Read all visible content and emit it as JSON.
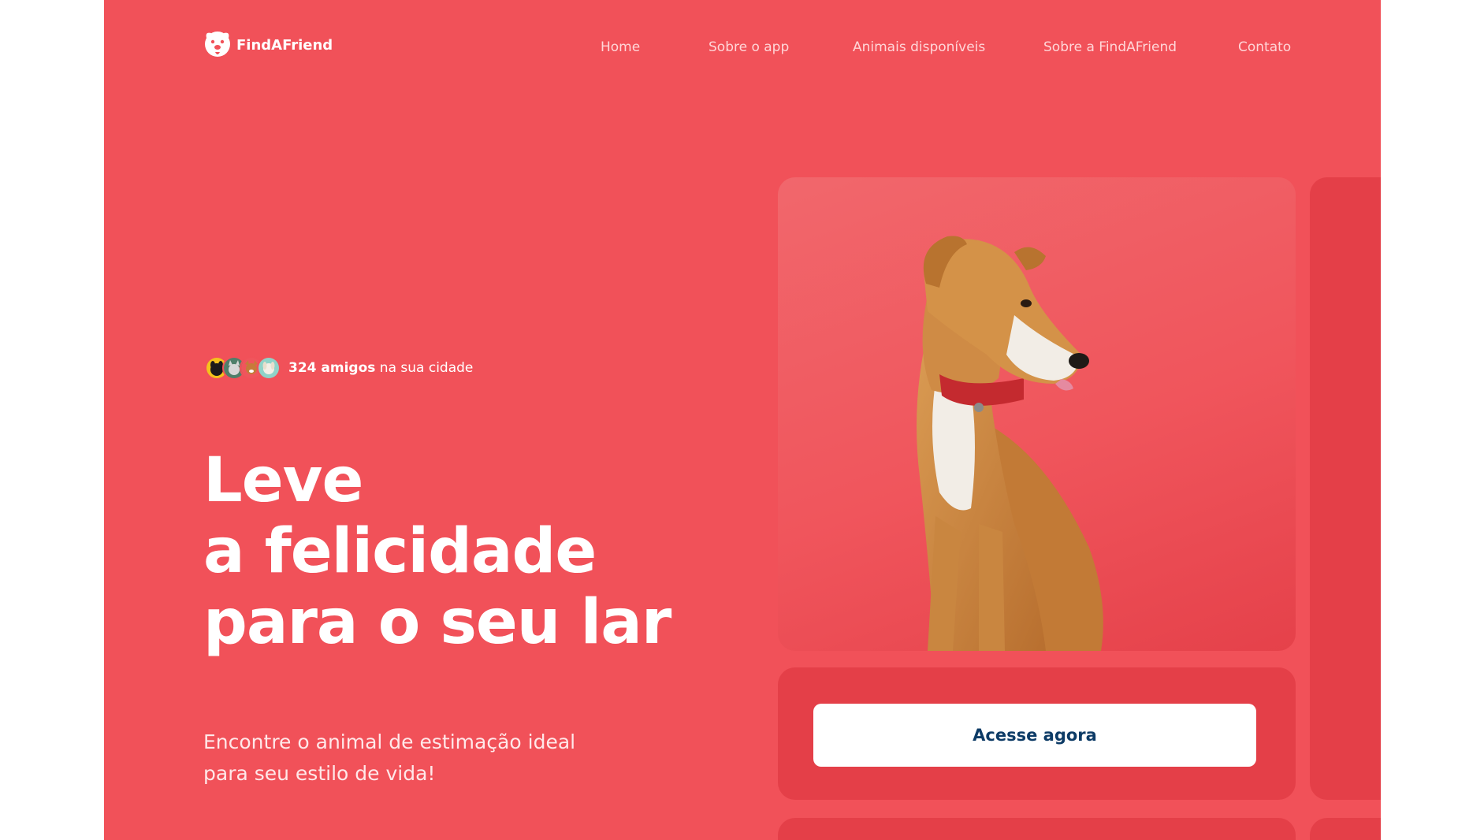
{
  "brand": {
    "name": "FindAFriend"
  },
  "nav": {
    "items": [
      {
        "label": "Home"
      },
      {
        "label": "Sobre o app"
      },
      {
        "label": "Animais disponíveis"
      },
      {
        "label": "Sobre a FindAFriend"
      },
      {
        "label": "Contato"
      }
    ]
  },
  "hero": {
    "friends_count": "324 amigos",
    "friends_suffix": " na sua cidade",
    "headline": [
      "Leve",
      "a felicidade",
      "para o seu lar"
    ],
    "subtitle": "Encontre o animal de estimação ideal para seu estilo de vida!",
    "cta_label": "Acesse agora"
  },
  "colors": {
    "background": "#f15159",
    "card_dark": "#e43f48",
    "button_text": "#0d3b66",
    "nav_text": "#ffd6d8"
  },
  "icons": [
    "dog-face-logo-icon",
    "pet-avatar-icons",
    "dog-photo"
  ]
}
